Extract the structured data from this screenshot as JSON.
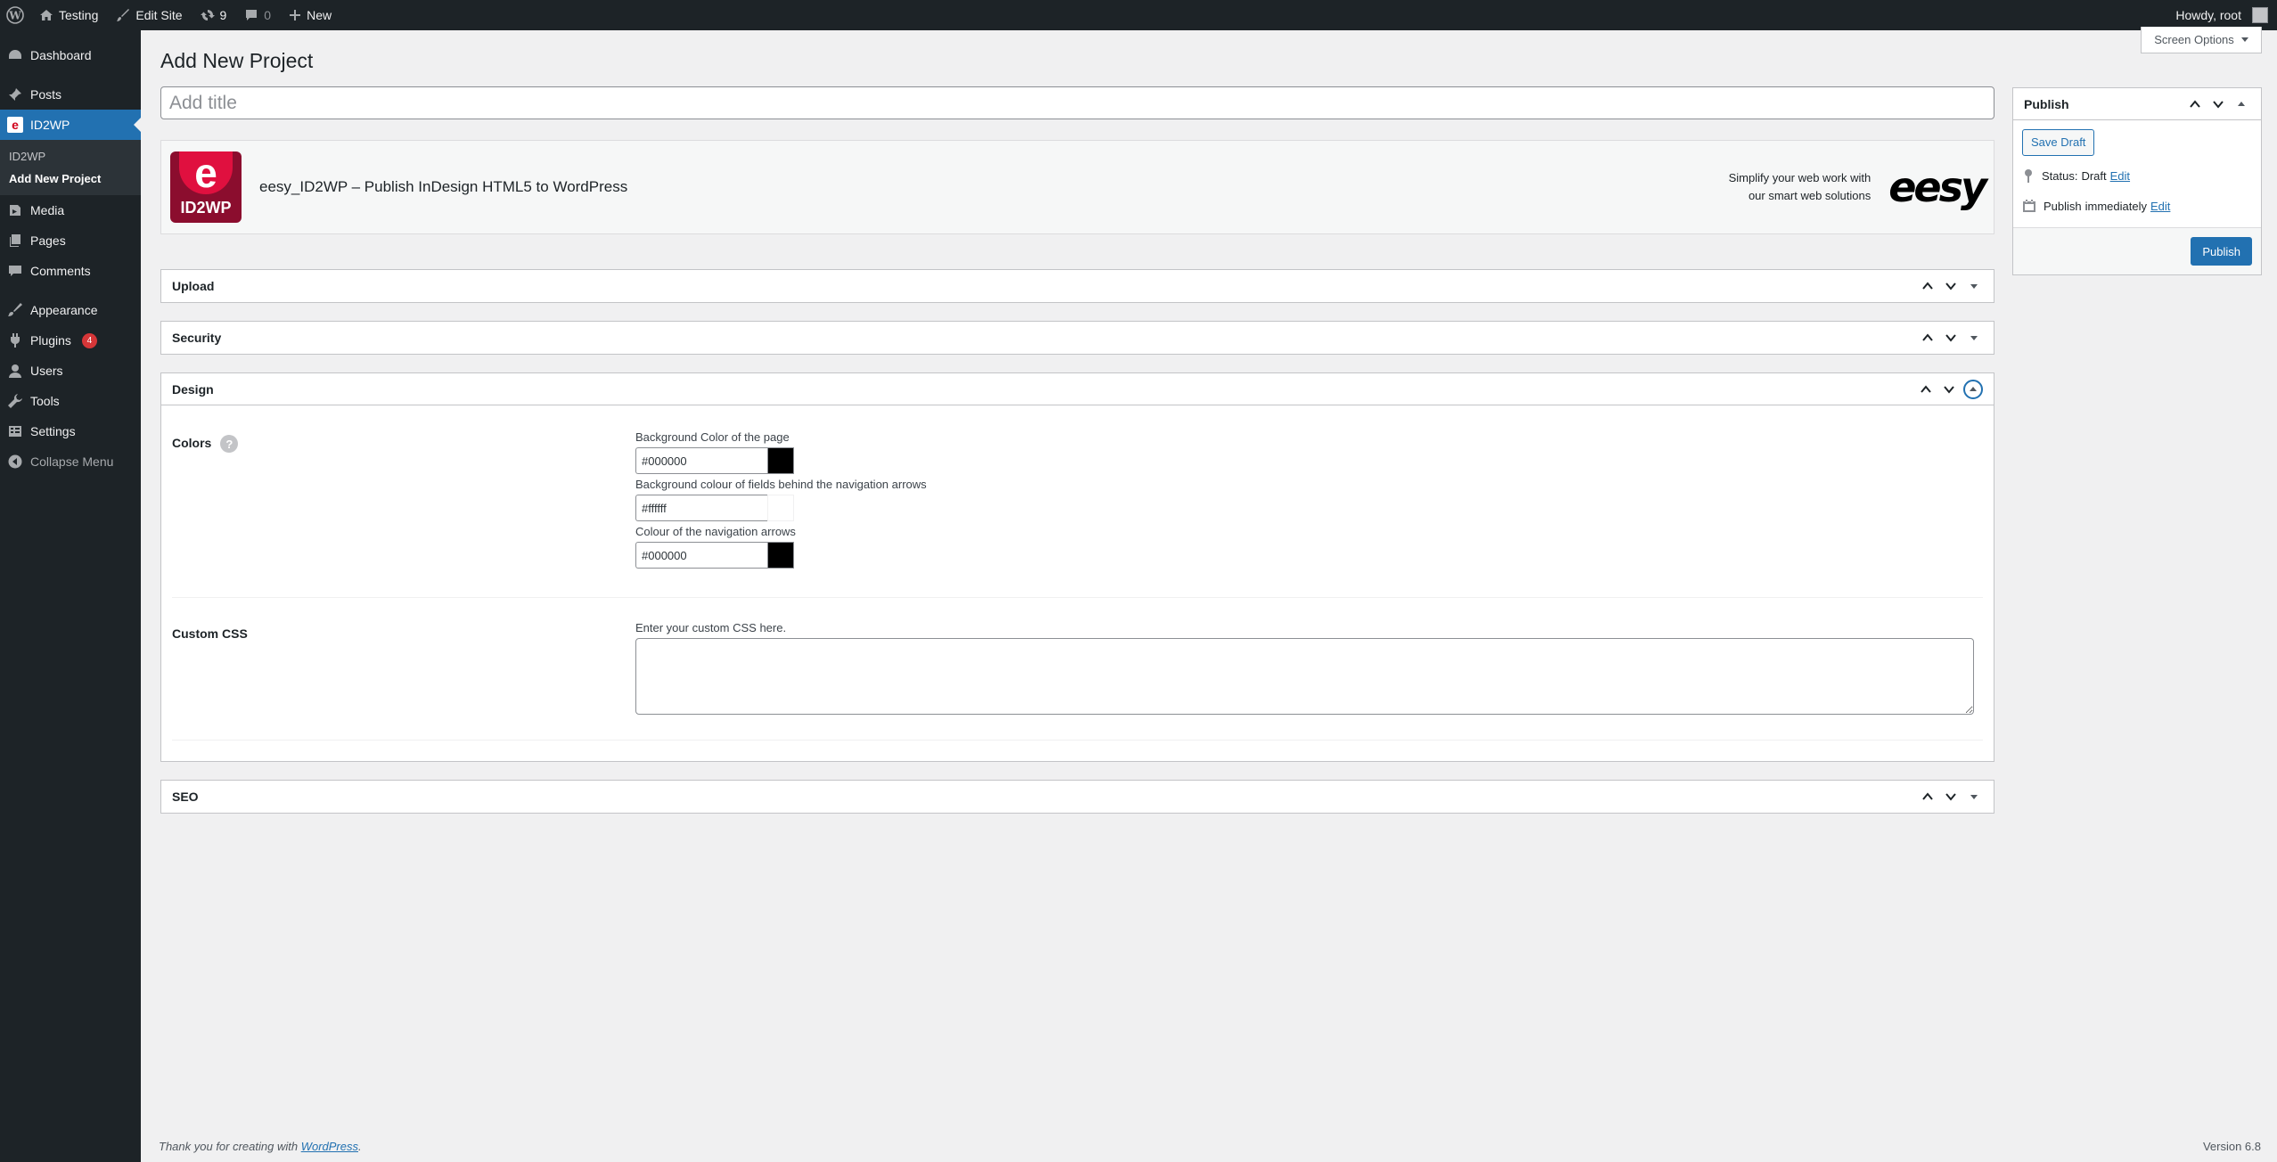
{
  "adminbar": {
    "site_name": "Testing",
    "edit_site": "Edit Site",
    "updates_count": "9",
    "comments_count": "0",
    "new_label": "New",
    "howdy": "Howdy, root"
  },
  "sidebar": {
    "items": [
      {
        "label": "Dashboard",
        "icon": "dashboard-icon"
      },
      {
        "label": "Posts",
        "icon": "pin-icon"
      },
      {
        "label": "ID2WP",
        "icon": "id2wp-icon"
      },
      {
        "label": "Media",
        "icon": "media-icon"
      },
      {
        "label": "Pages",
        "icon": "pages-icon"
      },
      {
        "label": "Comments",
        "icon": "comment-icon"
      },
      {
        "label": "Appearance",
        "icon": "brush-icon"
      },
      {
        "label": "Plugins",
        "icon": "plugin-icon",
        "badge": "4"
      },
      {
        "label": "Users",
        "icon": "user-icon"
      },
      {
        "label": "Tools",
        "icon": "wrench-icon"
      },
      {
        "label": "Settings",
        "icon": "settings-icon"
      },
      {
        "label": "Collapse Menu",
        "icon": "collapse-icon"
      }
    ],
    "submenu": [
      "ID2WP",
      "Add New Project"
    ]
  },
  "screen_options": "Screen Options",
  "page_title": "Add New Project",
  "title_placeholder": "Add title",
  "banner": {
    "logo_text": "ID2WP",
    "logo_letter": "e",
    "title": "eesy_ID2WP – Publish InDesign HTML5 to WordPress",
    "tagline_1": "Simplify your web work with",
    "tagline_2": "our smart web solutions",
    "brand": "eesy"
  },
  "panels": {
    "upload": "Upload",
    "security": "Security",
    "design": "Design",
    "seo": "SEO"
  },
  "design": {
    "colors_label": "Colors",
    "help": "?",
    "fields": [
      {
        "label": "Background Color of the page",
        "value": "#000000",
        "color": "#000000"
      },
      {
        "label": "Background colour of fields behind the navigation arrows",
        "value": "#ffffff",
        "color": "#ffffff"
      },
      {
        "label": "Colour of the navigation arrows",
        "value": "#000000",
        "color": "#000000"
      }
    ],
    "custom_css_label": "Custom CSS",
    "custom_css_hint": "Enter your custom CSS here."
  },
  "publish": {
    "title": "Publish",
    "save_draft": "Save Draft",
    "status_label": "Status:",
    "status_value": "Draft",
    "edit": "Edit",
    "publish_label": "Publish",
    "publish_value": "immediately",
    "publish_button": "Publish"
  },
  "footer": {
    "thanks_prefix": "Thank you for creating with ",
    "wordpress": "WordPress",
    "suffix": ".",
    "version": "Version 6.8"
  },
  "colors": {
    "accent": "#2271b1",
    "admin_dark": "#1d2327",
    "badge": "#d63638"
  }
}
